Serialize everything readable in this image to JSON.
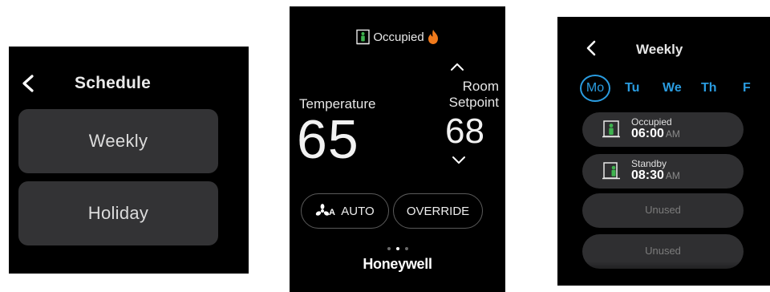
{
  "schedule_screen": {
    "title": "Schedule",
    "buttons": [
      "Weekly",
      "Holiday"
    ]
  },
  "home_screen": {
    "status": "Occupied",
    "temperature_label": "Temperature",
    "temperature_value": "65",
    "setpoint_label_line1": "Room",
    "setpoint_label_line2": "Setpoint",
    "setpoint_value": "68",
    "fan_icon_letter": "A",
    "fan_button": "AUTO",
    "override_button": "OVERRIDE",
    "page_indicator": {
      "total": 3,
      "active": 2
    },
    "brand": "Honeywell"
  },
  "weekly_screen": {
    "title": "Weekly",
    "days": [
      "Mo",
      "Tu",
      "We",
      "Th",
      "F"
    ],
    "selected_day": "Mo",
    "slots": [
      {
        "label": "Occupied",
        "time": "06:00",
        "ampm": "AM",
        "icon": "occupied-icon"
      },
      {
        "label": "Standby",
        "time": "08:30",
        "ampm": "AM",
        "icon": "standby-icon"
      },
      {
        "label": "Unused"
      },
      {
        "label": "Unused"
      }
    ]
  },
  "colors": {
    "screen_bg": "#000000",
    "button_bg": "#333335",
    "accent_blue": "#2a9ce0",
    "occupied_green": "#3fb34f",
    "flame_orange": "#f07a1c"
  }
}
